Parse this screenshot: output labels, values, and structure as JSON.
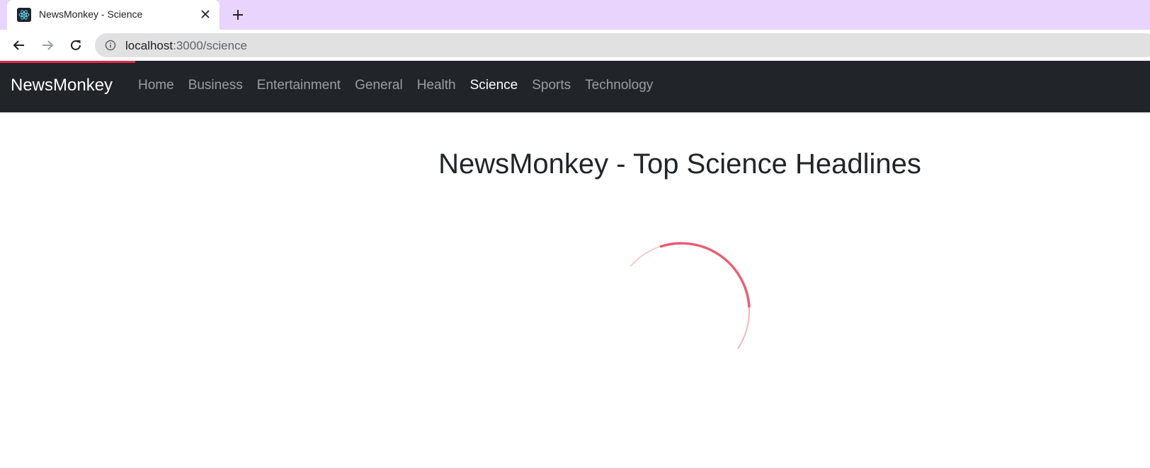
{
  "browser": {
    "tab_title": "NewsMonkey - Science",
    "url_host": "localhost",
    "url_path": ":3000/science"
  },
  "navbar": {
    "brand": "NewsMonkey",
    "links": [
      {
        "label": "Home",
        "active": false
      },
      {
        "label": "Business",
        "active": false
      },
      {
        "label": "Entertainment",
        "active": false
      },
      {
        "label": "General",
        "active": false
      },
      {
        "label": "Health",
        "active": false
      },
      {
        "label": "Science",
        "active": true
      },
      {
        "label": "Sports",
        "active": false
      },
      {
        "label": "Technology",
        "active": false
      }
    ]
  },
  "main": {
    "heading": "NewsMonkey - Top Science Headlines"
  },
  "colors": {
    "tabstrip": "#e8d4fc",
    "navbar": "#212529",
    "loader": "#e8274a",
    "spinner": "#e0455e"
  },
  "icons": {
    "favicon": "react-icon",
    "close": "close-icon",
    "new_tab": "plus-icon",
    "back": "arrow-left-icon",
    "forward": "arrow-right-icon",
    "reload": "reload-icon",
    "site_info": "info-icon",
    "loading": "spinner-icon"
  }
}
